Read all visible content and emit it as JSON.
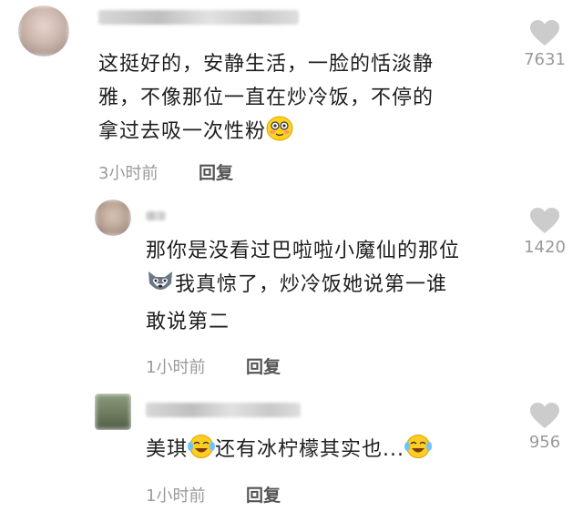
{
  "comments": [
    {
      "text_lines": [
        "这挺好的，安静生活，一脸的恬淡静",
        "雅，不像那位一直在炒冷饭，不停的",
        "拿过去吸一次性粉"
      ],
      "time": "3小时前",
      "reply_label": "回复",
      "likes": "7631"
    },
    {
      "text_lines": [
        "那你是没看过巴啦啦小魔仙的那位",
        "我真惊了，炒冷饭她说第一谁",
        "敢说第二"
      ],
      "time": "1小时前",
      "reply_label": "回复",
      "likes": "1420"
    },
    {
      "text_part1": "美琪",
      "text_part2": "还有冰柠檬其实也...",
      "time": "1小时前",
      "reply_label": "回复",
      "likes": "956"
    }
  ],
  "icons": {
    "like": "heart-icon",
    "emoji_smile": "blushing-smile-emoji",
    "emoji_husky": "husky-emoji",
    "emoji_laugh": "tears-of-joy-emoji"
  },
  "colors": {
    "heart": "#cccccc",
    "meta_text": "#9a9a9a",
    "reply_text": "#555555"
  }
}
